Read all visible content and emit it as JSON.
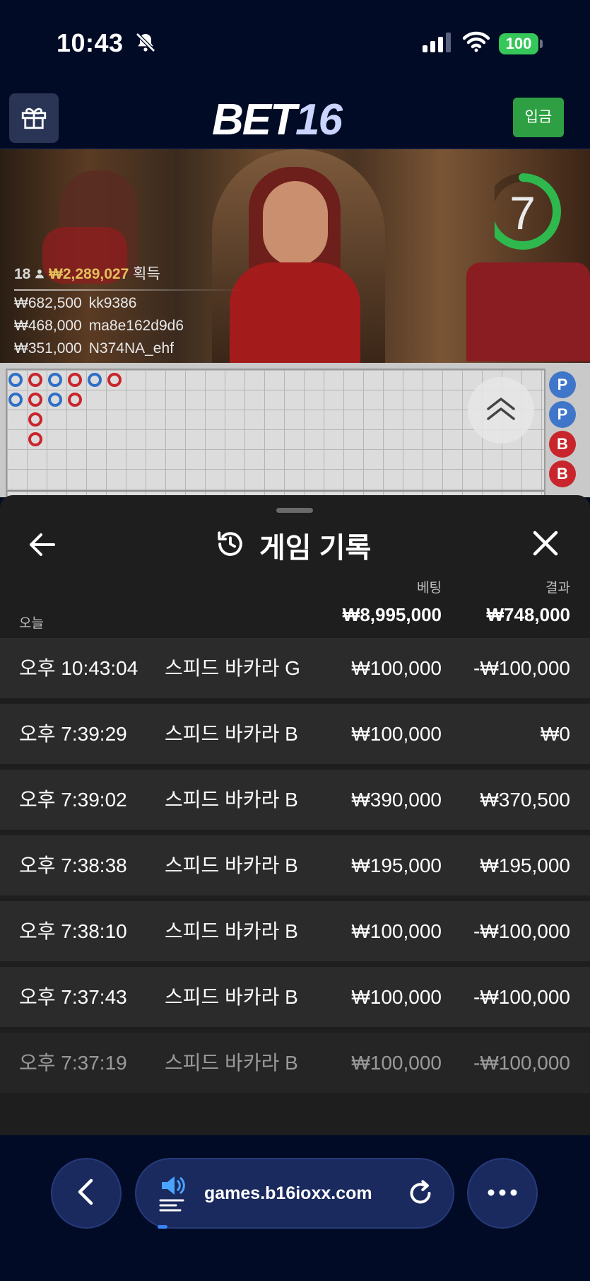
{
  "status_bar": {
    "time": "10:43",
    "battery": "100"
  },
  "header": {
    "logo_part1": "BET",
    "logo_part2": "16",
    "deposit_label": "입금"
  },
  "video": {
    "players_count": "18",
    "total_win": "₩2,289,027",
    "total_win_label": "획득",
    "winners": [
      {
        "amount": "₩682,500",
        "player": "kk9386"
      },
      {
        "amount": "₩468,000",
        "player": "ma8e162d9d6"
      },
      {
        "amount": "₩351,000",
        "player": "N374NA_ehf"
      }
    ],
    "timer": "7",
    "timer_fraction": 0.7
  },
  "roadmap": {
    "side_beads": [
      "P",
      "P",
      "B",
      "B"
    ]
  },
  "history": {
    "title": "게임 기록",
    "col_bet": "베팅",
    "col_result": "결과",
    "today_label": "오늘",
    "total_bet": "₩8,995,000",
    "total_result": "₩748,000",
    "rows": [
      {
        "time": "오후 10:43:04",
        "game": "스피드 바카라 G",
        "bet": "₩100,000",
        "result": "-₩100,000"
      },
      {
        "time": "오후 7:39:29",
        "game": "스피드 바카라 B",
        "bet": "₩100,000",
        "result": "₩0"
      },
      {
        "time": "오후 7:39:02",
        "game": "스피드 바카라 B",
        "bet": "₩390,000",
        "result": "₩370,500"
      },
      {
        "time": "오후 7:38:38",
        "game": "스피드 바카라 B",
        "bet": "₩195,000",
        "result": "₩195,000"
      },
      {
        "time": "오후 7:38:10",
        "game": "스피드 바카라 B",
        "bet": "₩100,000",
        "result": "-₩100,000"
      },
      {
        "time": "오후 7:37:43",
        "game": "스피드 바카라 B",
        "bet": "₩100,000",
        "result": "-₩100,000"
      },
      {
        "time": "오후 7:37:19",
        "game": "스피드 바카라 B",
        "bet": "₩100,000",
        "result": "-₩100,000"
      }
    ]
  },
  "browser": {
    "url": "games.b16ioxx.com"
  },
  "icons": [
    "bell-slash-icon",
    "signal-icon",
    "wifi-icon",
    "gift-icon",
    "person-icon",
    "chevrons-up-icon",
    "back-arrow-icon",
    "history-icon",
    "close-icon",
    "chevron-left-icon",
    "speaker-icon",
    "reload-icon",
    "more-icon"
  ]
}
